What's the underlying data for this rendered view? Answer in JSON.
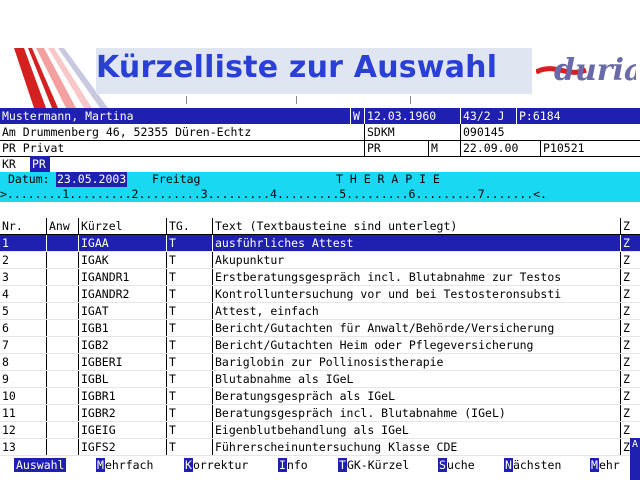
{
  "header": {
    "title": "Kürzelliste zur Auswahl",
    "logo_text": "duria",
    "colors": {
      "title": "#2a3fd6",
      "logo_wave": "#d42020",
      "logo_text": "#6a6aa8"
    }
  },
  "patient": {
    "name": "Mustermann, Martina",
    "gender": "W",
    "birthdate": "12.03.1960",
    "age": "43/2 J",
    "patient_no": "P:6184",
    "address": "Am Drummenberg 46, 52355 Düren-Echtz",
    "code1": "SDKM",
    "code2": "090145",
    "insurance_type": "PR Privat",
    "ins_short": "PR",
    "ins_flag": "M",
    "ins_date": "22.09.00",
    "ins_no": "P10521",
    "kr_label": "KR",
    "kr_value": "PR"
  },
  "datebar": {
    "label": "Datum:",
    "date": "23.05.2003",
    "weekday": "Freitag",
    "section": "T H E R A P I E"
  },
  "ruler": ">........1.........2.........3.........4.........5.........6.........7.......<.",
  "table": {
    "headers": {
      "nr": "Nr.",
      "anw": "Anw",
      "kuerzel": "Kürzel",
      "tg": "TG.",
      "text": "Text (Textbausteine sind unterlegt)",
      "z": "Z"
    },
    "rows": [
      {
        "nr": "1",
        "anw": "",
        "kuerzel": "IGAA",
        "tg": "T",
        "text": "ausführliches Attest",
        "z": "Z",
        "selected": true
      },
      {
        "nr": "2",
        "anw": "",
        "kuerzel": "IGAK",
        "tg": "T",
        "text": "Akupunktur",
        "z": "Z"
      },
      {
        "nr": "3",
        "anw": "",
        "kuerzel": "IGANDR1",
        "tg": "T",
        "text": "Erstberatungsgespräch incl. Blutabnahme zur Testos",
        "z": "Z"
      },
      {
        "nr": "4",
        "anw": "",
        "kuerzel": "IGANDR2",
        "tg": "T",
        "text": "Kontrolluntersuchung vor und bei Testosteronsubsti",
        "z": "Z"
      },
      {
        "nr": "5",
        "anw": "",
        "kuerzel": "IGAT",
        "tg": "T",
        "text": "Attest, einfach",
        "z": "Z"
      },
      {
        "nr": "6",
        "anw": "",
        "kuerzel": "IGB1",
        "tg": "T",
        "text": "Bericht/Gutachten für Anwalt/Behörde/Versicherung",
        "z": "Z"
      },
      {
        "nr": "7",
        "anw": "",
        "kuerzel": "IGB2",
        "tg": "T",
        "text": "Bericht/Gutachten Heim oder Pflegeversicherung",
        "z": "Z"
      },
      {
        "nr": "8",
        "anw": "",
        "kuerzel": "IGBERI",
        "tg": "T",
        "text": "Bariglobin zur Pollinosistherapie",
        "z": "Z"
      },
      {
        "nr": "9",
        "anw": "",
        "kuerzel": "IGBL",
        "tg": "T",
        "text": "Blutabnahme als IGeL",
        "z": "Z"
      },
      {
        "nr": "10",
        "anw": "",
        "kuerzel": "IGBR1",
        "tg": "T",
        "text": "Beratungsgespräch als IGeL",
        "z": "Z"
      },
      {
        "nr": "11",
        "anw": "",
        "kuerzel": "IGBR2",
        "tg": "T",
        "text": "Beratungsgespräch incl. Blutabnahme (IGeL)",
        "z": "Z"
      },
      {
        "nr": "12",
        "anw": "",
        "kuerzel": "IGEIG",
        "tg": "T",
        "text": "Eigenblutbehandlung als IGeL",
        "z": "Z"
      },
      {
        "nr": "13",
        "anw": "",
        "kuerzel": "IGFS2",
        "tg": "T",
        "text": "Führerscheinuntersuchung Klasse CDE",
        "z": "Z"
      }
    ]
  },
  "footer": {
    "buttons": [
      {
        "hotkey": "Auswahl",
        "rest": "",
        "full": true
      },
      {
        "hotkey": "M",
        "rest": "ehrfach"
      },
      {
        "hotkey": "K",
        "rest": "orrektur"
      },
      {
        "hotkey": "I",
        "rest": "nfo"
      },
      {
        "hotkey": "T",
        "rest": "GK-Kürzel"
      },
      {
        "hotkey": "S",
        "rest": "uche"
      },
      {
        "hotkey": "N",
        "rest": "ächsten"
      },
      {
        "hotkey": "M",
        "rest": "ehr"
      }
    ],
    "side_badge": "A"
  }
}
